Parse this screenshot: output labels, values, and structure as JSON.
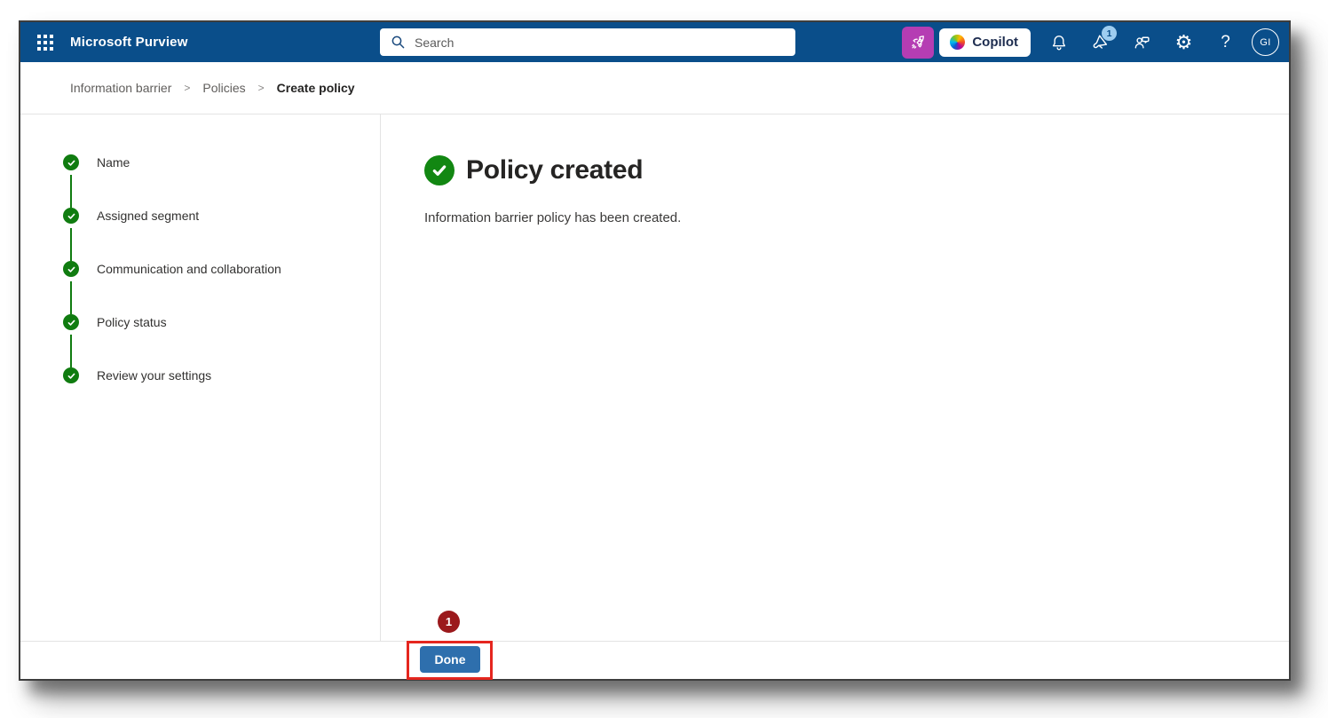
{
  "colors": {
    "header_blue": "#0a4e8a",
    "step_green": "#107c10",
    "button_blue": "#2e6fad",
    "annotation_red": "#e5261f",
    "annotation_circle_red": "#9b191c",
    "rocket_magenta": "#b53db3",
    "badge_blue": "#9ecdf0"
  },
  "header": {
    "app_title": "Microsoft Purview",
    "search_placeholder": "Search",
    "search_value": "",
    "copilot_label": "Copilot",
    "notification_badge": "1",
    "avatar_initials": "GI",
    "icons": [
      "waffle-icon",
      "search-icon",
      "rocket-icon",
      "copilot-logo",
      "bell-icon",
      "megaphone-icon",
      "feedback-icon",
      "gear-icon",
      "help-icon",
      "avatar"
    ]
  },
  "breadcrumb": {
    "items": [
      "Information barrier",
      "Policies",
      "Create policy"
    ],
    "separator": ">"
  },
  "wizard": {
    "steps": [
      {
        "label": "Name",
        "state": "completed"
      },
      {
        "label": "Assigned segment",
        "state": "completed"
      },
      {
        "label": "Communication and collaboration",
        "state": "completed"
      },
      {
        "label": "Policy status",
        "state": "completed"
      },
      {
        "label": "Review your settings",
        "state": "completed"
      }
    ]
  },
  "main": {
    "title": "Policy created",
    "message": "Information barrier policy has been created."
  },
  "footer": {
    "done_label": "Done"
  },
  "annotation": {
    "step_number": "1"
  }
}
